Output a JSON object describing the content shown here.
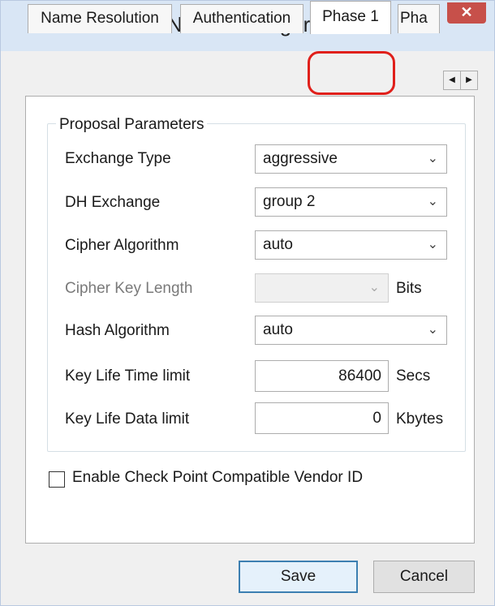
{
  "window": {
    "title": "VPN Site Configuration",
    "close_glyph": "✕"
  },
  "tabs": [
    {
      "label": "Name Resolution"
    },
    {
      "label": "Authentication"
    },
    {
      "label": "Phase 1",
      "active": true
    },
    {
      "label": "Pha"
    }
  ],
  "tab_scroll": {
    "left_glyph": "◀",
    "right_glyph": "▶"
  },
  "proposal": {
    "group_label": "Proposal Parameters",
    "exchange_type": {
      "label": "Exchange Type",
      "value": "aggressive"
    },
    "dh_exchange": {
      "label": "DH Exchange",
      "value": "group 2"
    },
    "cipher_algorithm": {
      "label": "Cipher Algorithm",
      "value": "auto"
    },
    "cipher_key_length": {
      "label": "Cipher Key Length",
      "value": "",
      "unit": "Bits",
      "disabled": true
    },
    "hash_algorithm": {
      "label": "Hash Algorithm",
      "value": "auto"
    },
    "key_life_time": {
      "label": "Key Life Time limit",
      "value": "86400",
      "unit": "Secs"
    },
    "key_life_data": {
      "label": "Key Life Data limit",
      "value": "0",
      "unit": "Kbytes"
    }
  },
  "vendor_id": {
    "label": "Enable Check Point Compatible Vendor ID",
    "checked": false
  },
  "buttons": {
    "save": "Save",
    "cancel": "Cancel"
  },
  "icons": {
    "dropdown": "chevron-down-icon",
    "close": "close-icon"
  },
  "colors": {
    "highlight": "#e0201b",
    "close": "#c7504a",
    "titlebar": "#d9e6f5"
  }
}
